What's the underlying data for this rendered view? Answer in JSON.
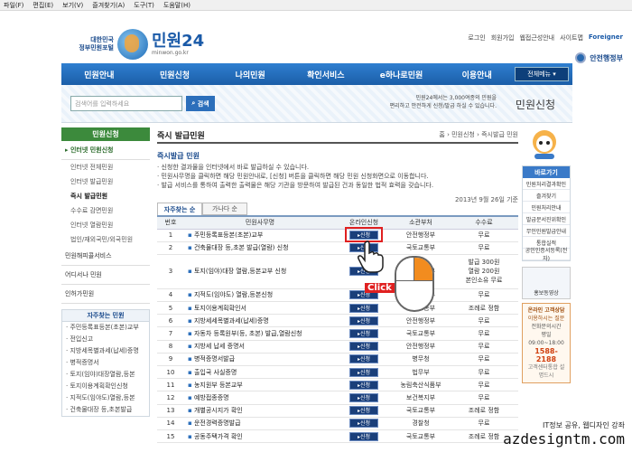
{
  "menubar": [
    "파일(F)",
    "편집(E)",
    "보기(V)",
    "즐겨찾기(A)",
    "도구(T)",
    "도움말(H)"
  ],
  "logo": {
    "gov_line1": "대한민국",
    "gov_line2": "정부민원포털",
    "name": "민원24",
    "url": "minwon.go.kr"
  },
  "toplinks": [
    "로그인",
    "회원가입",
    "웹접근성안내",
    "사이트맵",
    "Foreigner"
  ],
  "ministry": "안전행정부",
  "gnb": {
    "items": [
      "민원안내",
      "민원신청",
      "나의민원",
      "확인서비스",
      "e하나로민원",
      "이용안내"
    ],
    "all_menu": "전체메뉴 ▾"
  },
  "search": {
    "placeholder": "검색어를 입력하세요",
    "button": "검색",
    "band_line1": "민원24에서는 3,000여종의 민원을",
    "band_line2": "편리하고 안전하게 신청/발급 하실 수 있습니다.",
    "band_tag": "민원신청"
  },
  "lnb": {
    "head": "민원신청",
    "section_main": "▸ 인터넷 민원신청",
    "subs": [
      "인터넷 전체민원",
      "인터넷 발급민원",
      "즉시 발급민원",
      "수수료 감면민원",
      "인터넷 열람민원",
      "법인/재외국민/외국민원"
    ],
    "sections": [
      "민원해피콜서비스",
      "어디서나 민원",
      "인허가민원"
    ],
    "box_head": "자주찾는 민원",
    "box_items": [
      "주민등록표등본(초본)교부",
      "전입신고",
      "지방세목별과세(납세)증명",
      "병적증명서",
      "토지(임야)대장열람,등본",
      "토지이용계획확인신청",
      "지적도(임야도)열람,등본",
      "건축물대장 등,초본발급"
    ]
  },
  "content": {
    "title": "즉시 발급민원",
    "crumb": "홈 › 민원신청 › 즉시발급 민원",
    "sub_heading": "즉시발급 민원",
    "bullets": [
      "· 신청한 결과물을 인터넷에서 바로 발급하실 수 있습니다.",
      "· 민원사무명을 클릭하면 해당 민원안내로, [신청] 버튼을 클릭하면 해당 민원 신청화면으로 이동합니다.",
      "· 발급 서비스를 통하여 출력한 출력물은 해당 기관을 방문하여 발급된 건과 동일한 법적 효력을 갖습니다."
    ],
    "date": "2013년 9월 26일 기준",
    "tabs": [
      "자주찾는 순",
      "가나다 순"
    ],
    "table_headers": [
      "번호",
      "민원사무명",
      "온라인신청",
      "소관부처",
      "수수료"
    ],
    "apply_label": "▸신청",
    "rows": [
      {
        "no": "1",
        "name": "주민등록표등본(초본)교부",
        "dept": "안전행정부",
        "fee": "무료"
      },
      {
        "no": "2",
        "name": "건축물대장 등,초본 발급(열람) 신청",
        "dept": "국토교통부",
        "fee": "무료"
      },
      {
        "no": "3",
        "name": "토지(임야)대장 열람,등본교부 신청",
        "dept": "국토교통부",
        "fee": "발급 300원",
        "fee2": "열람 200원",
        "fee3": "본인소유 무료"
      },
      {
        "no": "4",
        "name": "지적도(임야도) 열람,등본신청",
        "dept": "국토교통부",
        "fee": "무료"
      },
      {
        "no": "5",
        "name": "토지이용계획확인서",
        "dept": "국토교통부",
        "fee": "조례로 정함"
      },
      {
        "no": "6",
        "name": "지방세세목별과세(납세)증명",
        "dept": "안전행정부",
        "fee": "무료"
      },
      {
        "no": "7",
        "name": "자동차 등록원부(등, 초본) 발급,열람신청",
        "dept": "국토교통부",
        "fee": "무료"
      },
      {
        "no": "8",
        "name": "지방세 납세 증명서",
        "dept": "안전행정부",
        "fee": "무료"
      },
      {
        "no": "9",
        "name": "병적증명서발급",
        "dept": "병무청",
        "fee": "무료"
      },
      {
        "no": "10",
        "name": "출입국 사실증명",
        "dept": "법무부",
        "fee": "무료"
      },
      {
        "no": "11",
        "name": "농지원부 등본교부",
        "dept": "농림축산식품부",
        "fee": "무료"
      },
      {
        "no": "12",
        "name": "예방접종증명",
        "dept": "보건복지부",
        "fee": "무료"
      },
      {
        "no": "13",
        "name": "개별공시지가 확인",
        "dept": "국토교통부",
        "fee": "조례로 정함"
      },
      {
        "no": "14",
        "name": "운전경력증명발급",
        "dept": "경찰청",
        "fee": "무료"
      },
      {
        "no": "15",
        "name": "공동주택가격 확인",
        "dept": "국토교통부",
        "fee": "조례로 정함"
      }
    ],
    "click_label": "Click"
  },
  "right": {
    "box_head": "바로가기",
    "items": [
      "민원처리결과확인",
      "즐겨찾기",
      "민원처리안내",
      "발급문서진위확인",
      "무인민원발급안내",
      "통합실적",
      "공인인증서등록(전자)"
    ],
    "promo": "홍보동영상",
    "call_title": "온라인 고객상담",
    "call_line": "이용하시는 질문",
    "call_hours": "전화문의시간",
    "call_time": "평일 09:00~18:00",
    "call_number": "1588-2188",
    "call_note": "고객센터통합 설명드시"
  },
  "watermark": {
    "line1": "IT정보 공유, 웹디자인 강좌",
    "line2": "azdesigntm.com"
  },
  "colors": {
    "gnb": "#1b5ea8",
    "lnb_head": "#3c8a3c",
    "highlight": "#e02020",
    "mouse_button": "#f28c1f"
  }
}
